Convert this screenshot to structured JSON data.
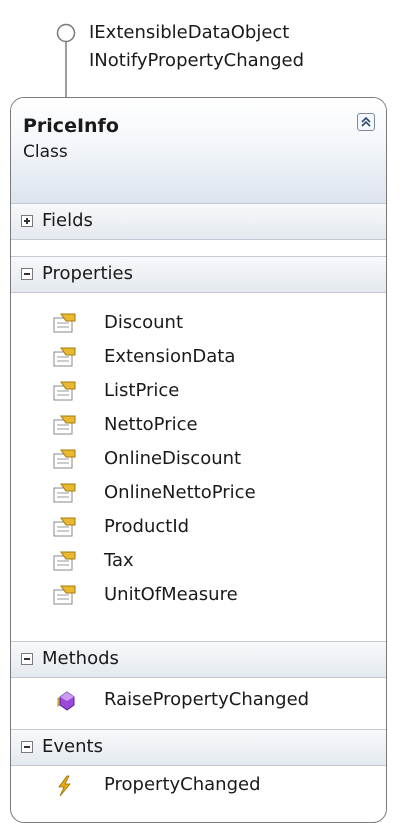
{
  "interfaces": [
    "IExtensibleDataObject",
    "INotifyPropertyChanged"
  ],
  "class": {
    "name": "PriceInfo",
    "stereotype": "Class",
    "sections": {
      "fields": {
        "label": "Fields",
        "expanded": false
      },
      "properties": {
        "label": "Properties",
        "expanded": true,
        "items": [
          "Discount",
          "ExtensionData",
          "ListPrice",
          "NettoPrice",
          "OnlineDiscount",
          "OnlineNettoPrice",
          "ProductId",
          "Tax",
          "UnitOfMeasure"
        ]
      },
      "methods": {
        "label": "Methods",
        "expanded": true,
        "items": [
          "RaisePropertyChanged"
        ]
      },
      "events": {
        "label": "Events",
        "expanded": true,
        "items": [
          "PropertyChanged"
        ]
      }
    }
  },
  "colors": {
    "border": "#7a7a7a",
    "header_gradient_end": "#dce4ee",
    "property_icon": "#e8b930",
    "method_icon": "#8a3bd1",
    "event_icon": "#d9a300"
  }
}
